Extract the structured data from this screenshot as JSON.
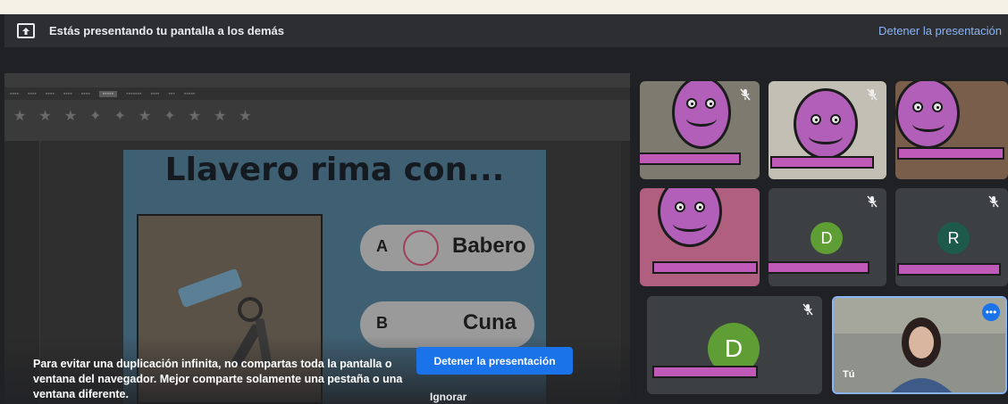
{
  "banner": {
    "icon": "present-screen-icon",
    "text": "Estás presentando tu pantalla a los demás",
    "stop_link": "Detener la presentación"
  },
  "slide": {
    "title": "Llavero rima con...",
    "options": [
      {
        "letter": "A",
        "word": "Babero"
      },
      {
        "letter": "B",
        "word": "Cuna"
      }
    ]
  },
  "warning": {
    "message": "Para evitar una duplicación infinita, no compartas toda la pantalla o ventana del navegador. Mejor comparte solamente una pestaña o una ventana diferente.",
    "stop_button": "Detener la presentación",
    "ignore_button": "Ignorar"
  },
  "participants": [
    {
      "type": "camera",
      "muted": true
    },
    {
      "type": "camera",
      "muted": true
    },
    {
      "type": "camera",
      "muted": false
    },
    {
      "type": "camera",
      "muted": false
    },
    {
      "type": "avatar",
      "initial": "D",
      "color": "#5f9d35",
      "muted": true
    },
    {
      "type": "avatar",
      "initial": "R",
      "color": "#1e5a4a",
      "muted": true
    },
    {
      "type": "avatar",
      "initial": "D",
      "color": "#5f9d35",
      "muted": true
    }
  ],
  "self": {
    "label": "Tú",
    "more_icon": "more-options-icon"
  },
  "colors": {
    "accent": "#1a73e8",
    "link": "#8ab4f8",
    "tile": "#3c4043",
    "redact": "#c05ab8"
  }
}
